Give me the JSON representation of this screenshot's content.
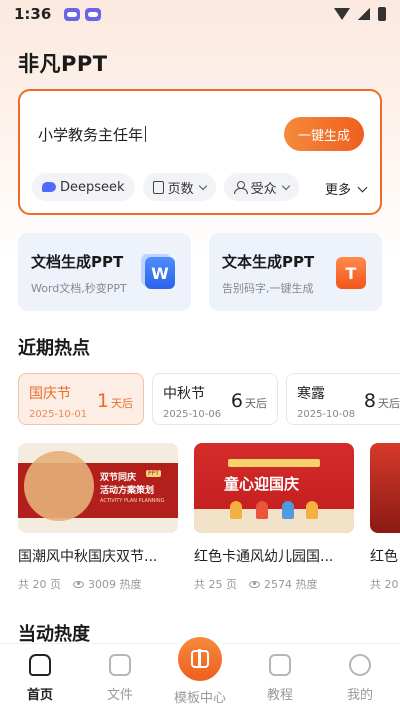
{
  "status_bar": {
    "time": "1:36"
  },
  "app_title": "非凡PPT",
  "prompt": {
    "value": "小学教务主任年",
    "generate_label": "一键生成",
    "chips": [
      {
        "label": "Deepseek",
        "icon": "deepseek-icon"
      },
      {
        "label": "页数",
        "icon": "pages-icon"
      },
      {
        "label": "受众",
        "icon": "audience-icon"
      }
    ],
    "more_label": "更多"
  },
  "features": [
    {
      "title": "文档生成PPT",
      "subtitle": "Word文档,秒变PPT",
      "icon": "word-icon",
      "icon_text": "W"
    },
    {
      "title": "文本生成PPT",
      "subtitle": "告别码字,一键生成",
      "icon": "text-icon",
      "icon_text": "T"
    }
  ],
  "hot_section_title": "近期热点",
  "hot_topics": [
    {
      "name": "国庆节",
      "date": "2025-10-01",
      "days": "1",
      "unit": "天后",
      "active": true
    },
    {
      "name": "中秋节",
      "date": "2025-10-06",
      "days": "6",
      "unit": "天后",
      "active": false
    },
    {
      "name": "寒露",
      "date": "2025-10-08",
      "days": "8",
      "unit": "天后",
      "active": false
    }
  ],
  "templates": [
    {
      "name": "国潮风中秋国庆双节...",
      "pages": "共 20 页",
      "heat": "3009 热度",
      "thumb_lines": [
        "双节同庆",
        "活动方案策划",
        "ACTIVITY PLAN PLANNING"
      ],
      "thumb_tag": "PPT"
    },
    {
      "name": "红色卡通风幼儿园国...",
      "pages": "共 25 页",
      "heat": "2574 热度",
      "thumb_lines": [
        "童心迎国庆"
      ]
    },
    {
      "name": "红色",
      "pages": "共 20"
    }
  ],
  "next_section_title": "当动热度",
  "nav": {
    "items": [
      {
        "label": "首页",
        "active": true
      },
      {
        "label": "文件",
        "active": false
      },
      {
        "label": "模板中心",
        "active": false
      },
      {
        "label": "教程",
        "active": false
      },
      {
        "label": "我的",
        "active": false
      }
    ]
  },
  "colors": {
    "accent": "#f06a2a",
    "feature_bg": "#eef2fb",
    "word_blue": "#2a63e8"
  }
}
